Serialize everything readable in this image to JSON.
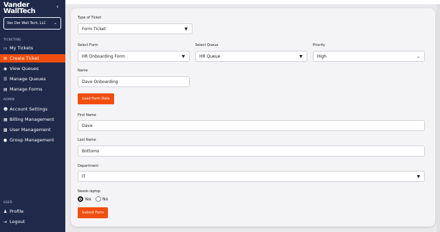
{
  "brand": {
    "line1": "Vander",
    "line2": "WallTech"
  },
  "org": {
    "name": "Van Der Wall Tech, LLC"
  },
  "sidebar": {
    "ticketing_heading": "TICKETING",
    "admin_heading": "ADMIN",
    "user_heading": "USER",
    "ticketing": [
      {
        "label": "My Tickets",
        "icon": "ticket-icon"
      },
      {
        "label": "Create Ticket",
        "icon": "plus-square-icon",
        "active": true
      },
      {
        "label": "View Queues",
        "icon": "eye-icon"
      },
      {
        "label": "Manage Queues",
        "icon": "list-icon"
      },
      {
        "label": "Manage Forms",
        "icon": "document-icon"
      }
    ],
    "admin": [
      {
        "label": "Account Settings",
        "icon": "user-circle-icon"
      },
      {
        "label": "Billing Management",
        "icon": "credit-card-icon"
      },
      {
        "label": "User Management",
        "icon": "users-icon"
      },
      {
        "label": "Group Management",
        "icon": "group-icon"
      }
    ],
    "user": [
      {
        "label": "Profile",
        "icon": "profile-icon"
      },
      {
        "label": "Logout",
        "icon": "logout-icon"
      }
    ]
  },
  "form": {
    "type_label": "Type of Ticket",
    "type_value": "Form Ticket",
    "select_form_label": "Select Form",
    "select_form_value": "HR Onboarding Form",
    "select_queue_label": "Select Queue",
    "select_queue_value": "HR Queue",
    "priority_label": "Priority",
    "priority_value": "High",
    "name_label": "Name",
    "name_value": "Dave Onboarding",
    "load_button": "Load Form Data",
    "first_name_label": "First Name",
    "first_name_value": "Dave",
    "last_name_label": "Last Name",
    "last_name_value": "Bottoms",
    "department_label": "Department",
    "department_value": "IT",
    "laptop_label": "Needs laptop",
    "yes_label": "Yes",
    "no_label": "No",
    "laptop_selected": "Yes",
    "submit_button": "Submit Form"
  },
  "colors": {
    "sidebar": "#1f2a4a",
    "accent": "#f04e0f",
    "background": "#e9e9ec"
  }
}
